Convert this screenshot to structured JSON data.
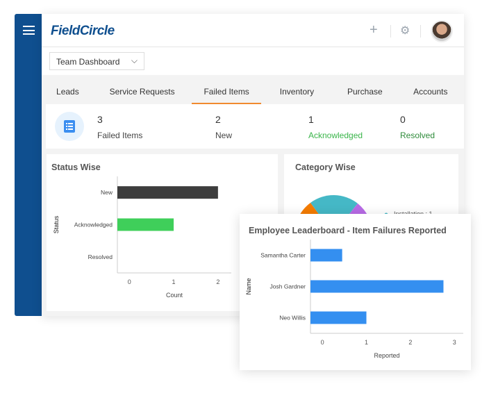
{
  "app": {
    "logo": "FieldCircle",
    "brand_color": "#0f4f8f"
  },
  "header": {
    "icons": [
      "plus-icon",
      "gear-icon",
      "avatar"
    ]
  },
  "dashboard_select": {
    "value": "Team Dashboard"
  },
  "tabs": [
    {
      "label": "Leads"
    },
    {
      "label": "Service Requests"
    },
    {
      "label": "Failed Items",
      "active": true
    },
    {
      "label": "Inventory"
    },
    {
      "label": "Purchase"
    },
    {
      "label": "Accounts"
    }
  ],
  "stats": [
    {
      "value": "3",
      "label": "Failed Items",
      "color": "#444444"
    },
    {
      "value": "2",
      "label": "New",
      "color": "#444444"
    },
    {
      "value": "1",
      "label": "Acknowledged",
      "color": "#3ab54a"
    },
    {
      "value": "0",
      "label": "Resolved",
      "color": "#2e8b3a"
    }
  ],
  "chart_data": [
    {
      "type": "bar",
      "orientation": "horizontal",
      "title": "Status Wise",
      "xlabel": "Count",
      "ylabel": "Status",
      "categories": [
        "New",
        "Acknowledged",
        "Resolved"
      ],
      "values": [
        2,
        1,
        0
      ],
      "colors": [
        "#3d3d3d",
        "#3fcf5a",
        "#cccccc"
      ],
      "xticks": [
        "0",
        "1",
        "2"
      ],
      "xlim": [
        -0.27,
        2.3
      ]
    },
    {
      "type": "pie",
      "title": "Category Wise",
      "legend": [
        {
          "label": "Installation : 1",
          "color": "#45b8c6"
        }
      ],
      "slice_colors": [
        "#f57c00",
        "#45b8c6",
        "#b86be6"
      ]
    },
    {
      "type": "bar",
      "orientation": "horizontal",
      "title": "Employee Leaderboard - Item Failures Reported",
      "xlabel": "Reported",
      "ylabel": "Name",
      "categories": [
        "Samantha Carter",
        "Josh Gardner",
        "Neo Willis"
      ],
      "values": [
        0.45,
        2.75,
        1
      ],
      "color": "#348ff0",
      "xticks": [
        "0",
        "1",
        "2",
        "3"
      ],
      "xlim": [
        -0.27,
        3.2
      ]
    }
  ]
}
